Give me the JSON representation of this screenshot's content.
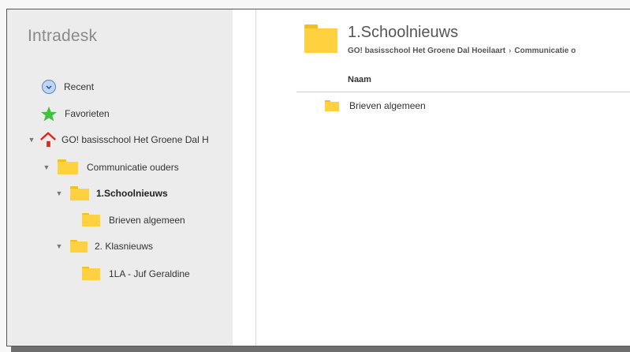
{
  "app": {
    "title": "Intradesk"
  },
  "sidebar": {
    "recent": "Recent",
    "favorites": "Favorieten",
    "tree": {
      "school": "GO! basisschool Het Groene Dal H",
      "communicatie": "Communicatie ouders",
      "schoolnieuws": "1.Schoolnieuws",
      "brieven": "Brieven algemeen",
      "klasnieuws": "2. Klasnieuws",
      "klas_1la": "1LA - Juf Geraldine"
    }
  },
  "main": {
    "folder_title": "1.Schoolnieuws",
    "breadcrumb": [
      "GO! basisschool Het Groene Dal Hoeilaart",
      "Communicatie o"
    ],
    "breadcrumb_separator": "›",
    "column_name": "Naam",
    "items": [
      {
        "name": "Brieven algemeen"
      }
    ]
  },
  "colors": {
    "folder": "#ffd13e",
    "folder_dark": "#f3bf1f",
    "star": "#3fc33f",
    "home_roof": "#e2231a",
    "sidebar_bg": "#ececec"
  }
}
